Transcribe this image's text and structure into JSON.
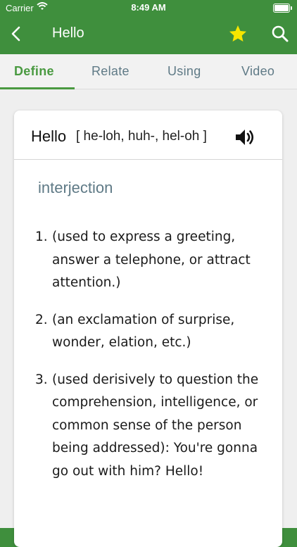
{
  "status_bar": {
    "carrier": "Carrier",
    "time": "8:49 AM"
  },
  "nav": {
    "title": "Hello",
    "back_icon": "chevron-left-icon",
    "star_icon": "star-icon",
    "search_icon": "search-icon",
    "star_color": "#f6e600"
  },
  "tabs": [
    {
      "label": "Define",
      "active": true
    },
    {
      "label": "Relate",
      "active": false
    },
    {
      "label": "Using",
      "active": false
    },
    {
      "label": "Video",
      "active": false
    }
  ],
  "entry": {
    "word": "Hello",
    "pronunciation": "[ he-loh, huh-, hel-oh  ]",
    "part_of_speech": "interjection",
    "definitions": [
      {
        "num": "1.",
        "text": "(used to express a greeting, answer a telephone, or attract attention.)"
      },
      {
        "num": "2.",
        "text": "(an exclamation of surprise, wonder, elation, etc.)"
      },
      {
        "num": "3.",
        "text": "(used derisively to question the comprehension, intelligence, or common sense of the person being addressed): You're gonna go out with him? Hello!"
      }
    ]
  },
  "colors": {
    "brand_green": "#3f8f3d",
    "tab_active": "#4a9a41",
    "tab_inactive": "#5f7a86"
  }
}
